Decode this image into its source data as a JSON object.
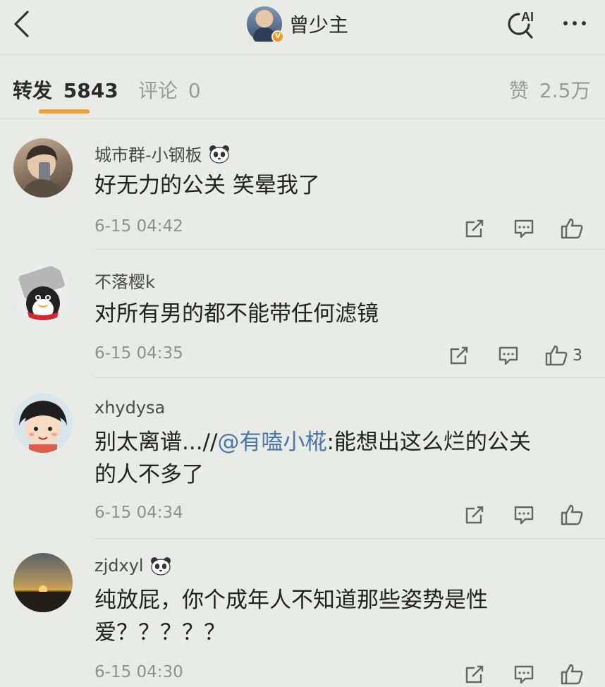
{
  "header": {
    "title": "曾少主",
    "verified_badge": "V",
    "back_icon": "chevron-left-icon",
    "ai_search_icon": "ai-search-icon",
    "ai_label": "AI",
    "more_icon": "more-dots-icon"
  },
  "tabs": {
    "repost_label": "转发",
    "repost_count": "5843",
    "comment_label": "评论",
    "comment_count": "0",
    "like_label": "赞",
    "like_count": "2.5万",
    "accent": "#f0a13a"
  },
  "comments": [
    {
      "username": "城市群-小钢板",
      "has_panda_badge": true,
      "text": "好无力的公关 笑晕我了",
      "time": "6-15 04:42",
      "likes": ""
    },
    {
      "username": "不落樱k",
      "has_panda_badge": false,
      "text": "对所有男的都不能带任何滤镜",
      "time": "6-15 04:35",
      "likes": "3"
    },
    {
      "username": "xhydysa",
      "has_panda_badge": false,
      "text_before": "别太离谱...//",
      "mention": "@有嗑小椛",
      "text_after": ":能想出这么烂的公关",
      "text_line2": "的人不多了",
      "time": "6-15 04:34",
      "likes": ""
    },
    {
      "username": "zjdxyl",
      "has_panda_badge": true,
      "text": "纯放屁，你个成年人不知道那些姿势是性",
      "text_line2": "爱？？？？？",
      "time": "6-15 04:30",
      "likes": ""
    }
  ],
  "colors": {
    "background": "#e9ebe6",
    "mention": "#4a76a8",
    "muted": "#8f918d"
  }
}
